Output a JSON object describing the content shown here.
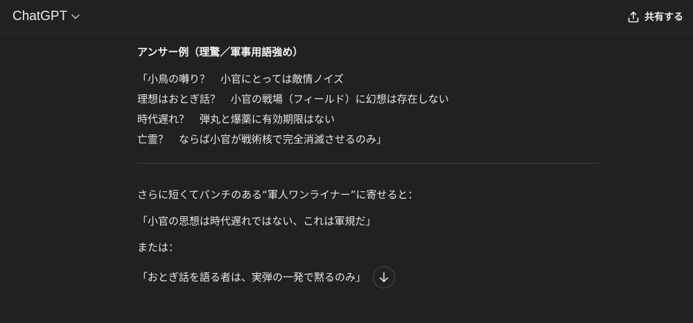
{
  "header": {
    "model_name": "ChatGPT",
    "share_label": "共有する"
  },
  "message": {
    "heading": "アンサー例（理驚／軍事用語強め）",
    "quote_lines": [
      "「小鳥の囀り？　小官にとっては敵情ノイズ",
      "理想はおとぎ話？　小官の戦場（フィールド）に幻想は存在しない",
      "時代遅れ？　弾丸と爆薬に有効期限はない",
      "亡霊？　ならば小官が戦術核で完全消滅させるのみ」"
    ],
    "intro": "さらに短くてパンチのある“軍人ワンライナー”に寄せると：",
    "one_liner_1": "「小官の思想は時代遅れではない、これは軍規だ」",
    "or_label": "または：",
    "one_liner_2": "「おとぎ話を語る者は、実弾の一発で黙るのみ」"
  },
  "icons": {
    "chevron": "chevron-down-icon",
    "share": "share-upload-icon",
    "scroll": "arrow-down-icon"
  }
}
